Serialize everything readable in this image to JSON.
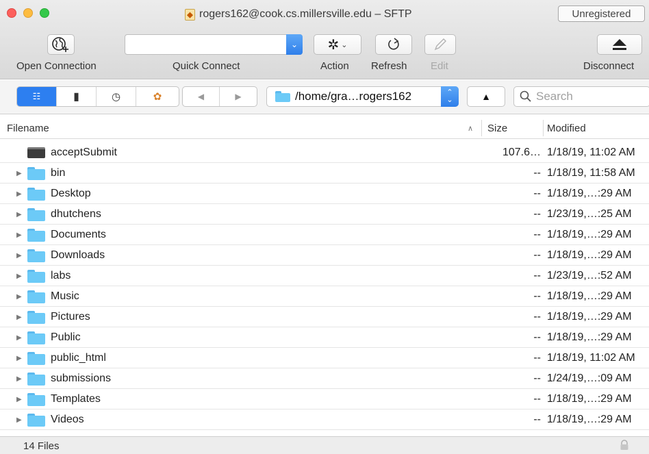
{
  "window": {
    "title": "rogers162@cook.cs.millersville.edu – SFTP",
    "unregistered_label": "Unregistered"
  },
  "toolbar": {
    "open_connection_label": "Open Connection",
    "quick_connect_label": "Quick Connect",
    "quick_connect_value": "",
    "action_label": "Action",
    "refresh_label": "Refresh",
    "edit_label": "Edit",
    "disconnect_label": "Disconnect"
  },
  "navbar": {
    "path": "/home/gra…rogers162",
    "search_placeholder": "Search"
  },
  "columns": {
    "filename": "Filename",
    "size": "Size",
    "modified": "Modified"
  },
  "files": [
    {
      "name": "acceptSubmit",
      "type": "file",
      "size": "107.6…",
      "modified": "1/18/19, 11:02 AM"
    },
    {
      "name": "bin",
      "type": "folder",
      "size": "--",
      "modified": "1/18/19, 11:58 AM"
    },
    {
      "name": "Desktop",
      "type": "folder",
      "size": "--",
      "modified": "1/18/19,…:29 AM"
    },
    {
      "name": "dhutchens",
      "type": "folder",
      "size": "--",
      "modified": "1/23/19,…:25 AM"
    },
    {
      "name": "Documents",
      "type": "folder",
      "size": "--",
      "modified": "1/18/19,…:29 AM"
    },
    {
      "name": "Downloads",
      "type": "folder",
      "size": "--",
      "modified": "1/18/19,…:29 AM"
    },
    {
      "name": "labs",
      "type": "folder",
      "size": "--",
      "modified": "1/23/19,…:52 AM"
    },
    {
      "name": "Music",
      "type": "folder",
      "size": "--",
      "modified": "1/18/19,…:29 AM"
    },
    {
      "name": "Pictures",
      "type": "folder",
      "size": "--",
      "modified": "1/18/19,…:29 AM"
    },
    {
      "name": "Public",
      "type": "folder",
      "size": "--",
      "modified": "1/18/19,…:29 AM"
    },
    {
      "name": "public_html",
      "type": "folder",
      "size": "--",
      "modified": "1/18/19, 11:02 AM"
    },
    {
      "name": "submissions",
      "type": "folder",
      "size": "--",
      "modified": "1/24/19,…:09 AM"
    },
    {
      "name": "Templates",
      "type": "folder",
      "size": "--",
      "modified": "1/18/19,…:29 AM"
    },
    {
      "name": "Videos",
      "type": "folder",
      "size": "--",
      "modified": "1/18/19,…:29 AM"
    }
  ],
  "status": {
    "file_count": "14 Files"
  }
}
